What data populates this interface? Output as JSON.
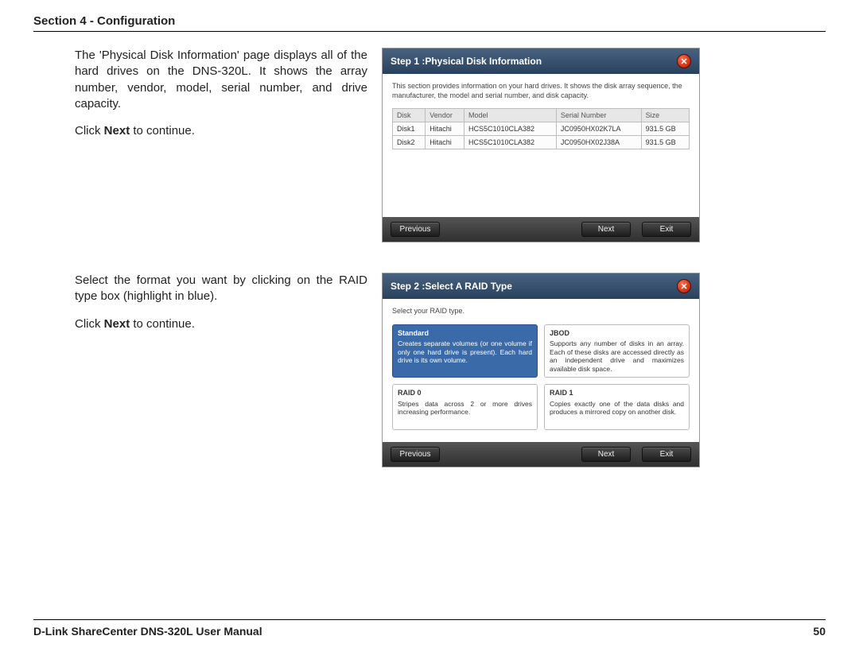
{
  "header": {
    "title": "Section 4 - Configuration"
  },
  "footer": {
    "left": "D-Link ShareCenter DNS-320L User Manual",
    "right": "50"
  },
  "block1": {
    "p1": "The 'Physical Disk Information' page displays all of the hard drives on the DNS-320L. It shows the array number, vendor, model, serial number, and drive capacity.",
    "p2a": "Click ",
    "p2b": "Next",
    "p2c": " to continue.",
    "panel": {
      "title": "Step 1 :Physical Disk Information",
      "desc": "This section provides information on your hard drives. It shows the disk array sequence, the manufacturer, the model and serial number, and disk capacity.",
      "cols": {
        "c1": "Disk",
        "c2": "Vendor",
        "c3": "Model",
        "c4": "Serial Number",
        "c5": "Size"
      },
      "rows": [
        {
          "c1": "Disk1",
          "c2": "Hitachi",
          "c3": "HCS5C1010CLA382",
          "c4": "JC0950HX02K7LA",
          "c5": "931.5 GB"
        },
        {
          "c1": "Disk2",
          "c2": "Hitachi",
          "c3": "HCS5C1010CLA382",
          "c4": "JC0950HX02J38A",
          "c5": "931.5 GB"
        }
      ],
      "prev": "Previous",
      "next": "Next",
      "exit": "Exit"
    }
  },
  "block2": {
    "p1": "Select the format you want by clicking on the RAID type box (highlight in blue).",
    "p2a": "Click ",
    "p2b": "Next",
    "p2c": " to continue.",
    "panel": {
      "title": "Step 2 :Select A RAID Type",
      "desc": "Select your RAID type.",
      "opts": [
        {
          "t": "Standard",
          "d": "Creates separate volumes (or one volume if only one hard drive is present). Each hard drive is its own volume.",
          "sel": true
        },
        {
          "t": "JBOD",
          "d": "Supports any number of disks in an array. Each of these disks are accessed directly as an independent drive and maximizes available disk space.",
          "sel": false
        },
        {
          "t": "RAID 0",
          "d": "Stripes data across 2 or more drives increasing performance.",
          "sel": false
        },
        {
          "t": "RAID 1",
          "d": "Copies exactly one of the data disks and produces a mirrored copy on another disk.",
          "sel": false
        }
      ],
      "prev": "Previous",
      "next": "Next",
      "exit": "Exit"
    }
  }
}
